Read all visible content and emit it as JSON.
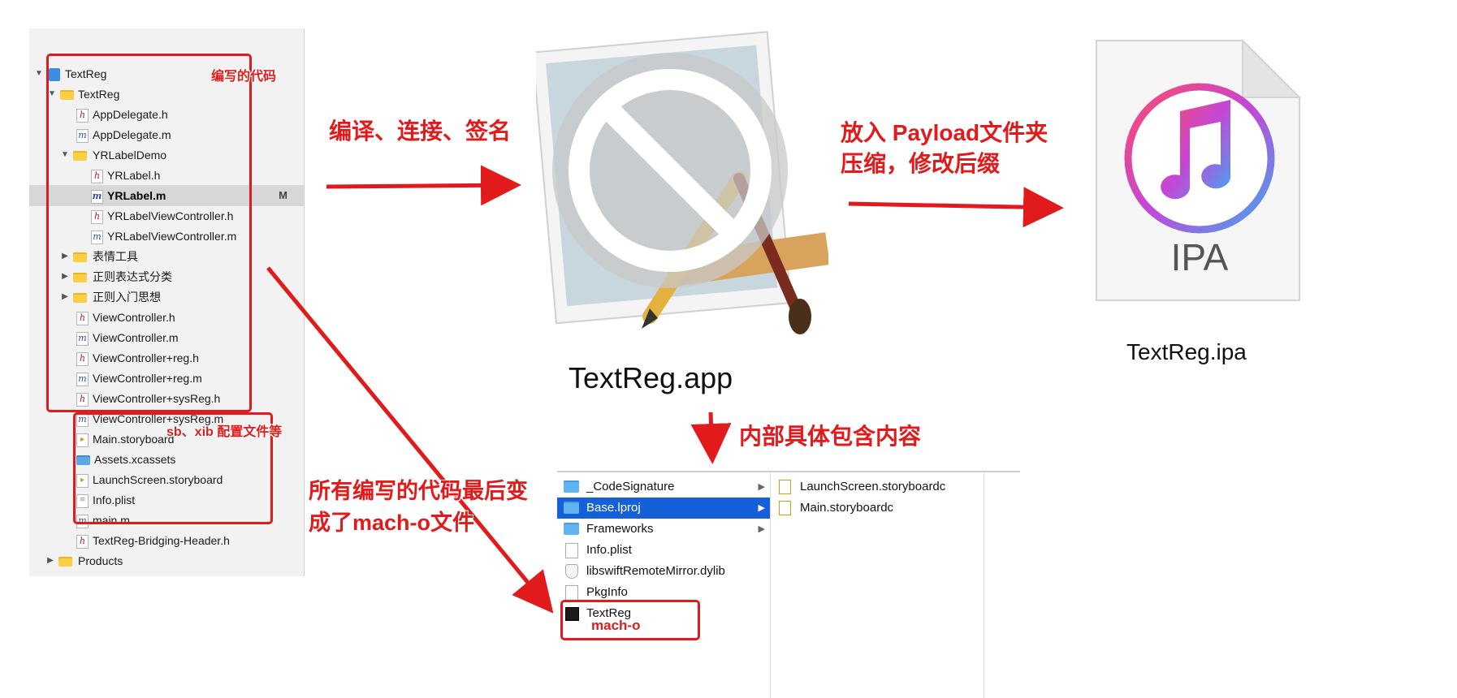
{
  "navigator": {
    "rows": [
      {
        "label": "TextReg",
        "icon": "project-icon"
      },
      {
        "label": "TextReg",
        "icon": "folder-icon"
      },
      {
        "label": "AppDelegate.h",
        "icon": "header-file-icon",
        "glyph": "h"
      },
      {
        "label": "AppDelegate.m",
        "icon": "objc-file-icon",
        "glyph": "m"
      },
      {
        "label": "YRLabelDemo",
        "icon": "folder-icon"
      },
      {
        "label": "YRLabel.h",
        "icon": "header-file-icon",
        "glyph": "h"
      },
      {
        "label": "YRLabel.m",
        "icon": "objc-file-icon",
        "glyph": "m",
        "status": "M"
      },
      {
        "label": "YRLabelViewController.h",
        "icon": "header-file-icon",
        "glyph": "h"
      },
      {
        "label": "YRLabelViewController.m",
        "icon": "objc-file-icon",
        "glyph": "m"
      },
      {
        "label": "表情工具",
        "icon": "folder-icon"
      },
      {
        "label": "正则表达式分类",
        "icon": "folder-icon"
      },
      {
        "label": "正则入门思想",
        "icon": "folder-icon"
      },
      {
        "label": "ViewController.h",
        "icon": "header-file-icon",
        "glyph": "h"
      },
      {
        "label": "ViewController.m",
        "icon": "objc-file-icon",
        "glyph": "m"
      },
      {
        "label": "ViewController+reg.h",
        "icon": "header-file-icon",
        "glyph": "h"
      },
      {
        "label": "ViewController+reg.m",
        "icon": "objc-file-icon",
        "glyph": "m"
      },
      {
        "label": "ViewController+sysReg.h",
        "icon": "header-file-icon",
        "glyph": "h"
      },
      {
        "label": "ViewController+sysReg.m",
        "icon": "objc-file-icon",
        "glyph": "m"
      },
      {
        "label": "Main.storyboard",
        "icon": "storyboard-icon"
      },
      {
        "label": "Assets.xcassets",
        "icon": "asset-catalog-icon"
      },
      {
        "label": "LaunchScreen.storyboard",
        "icon": "storyboard-icon"
      },
      {
        "label": "Info.plist",
        "icon": "plist-icon"
      },
      {
        "label": "main.m",
        "icon": "objc-file-icon",
        "glyph": "m"
      },
      {
        "label": "TextReg-Bridging-Header.h",
        "icon": "header-file-icon",
        "glyph": "h"
      },
      {
        "label": "Products",
        "icon": "folder-icon"
      }
    ]
  },
  "annotations": {
    "written_code": "编写的代码",
    "config_files": "sb、xib 配置文件等",
    "compile_link_sign": "编译、连接、签名",
    "payload_line1": "放入 Payload文件夹",
    "payload_line2": "压缩，修改后缀",
    "contents": "内部具体包含内容",
    "machO_line1": "所有编写的代码最后变",
    "machO_line2": "成了mach-o文件",
    "machO_tag": "mach-o"
  },
  "app": {
    "caption": "TextReg.app"
  },
  "ipa": {
    "icon_text": "IPA",
    "caption": "TextReg.ipa"
  },
  "finder": {
    "col1": [
      {
        "label": "_CodeSignature",
        "icon": "folder-icon",
        "has_children": true
      },
      {
        "label": "Base.lproj",
        "icon": "folder-icon",
        "has_children": true,
        "selected": true
      },
      {
        "label": "Frameworks",
        "icon": "folder-icon",
        "has_children": true
      },
      {
        "label": "Info.plist",
        "icon": "plist-icon"
      },
      {
        "label": "libswiftRemoteMirror.dylib",
        "icon": "dylib-icon"
      },
      {
        "label": "PkgInfo",
        "icon": "document-icon"
      },
      {
        "label": "TextReg",
        "icon": "executable-icon"
      }
    ],
    "col2": [
      {
        "label": "LaunchScreen.storyboardc",
        "icon": "storyboard-icon"
      },
      {
        "label": "Main.storyboardc",
        "icon": "storyboard-icon"
      }
    ]
  },
  "colors": {
    "annotation_red": "#e11b1b",
    "finder_selection": "#1560d9"
  }
}
